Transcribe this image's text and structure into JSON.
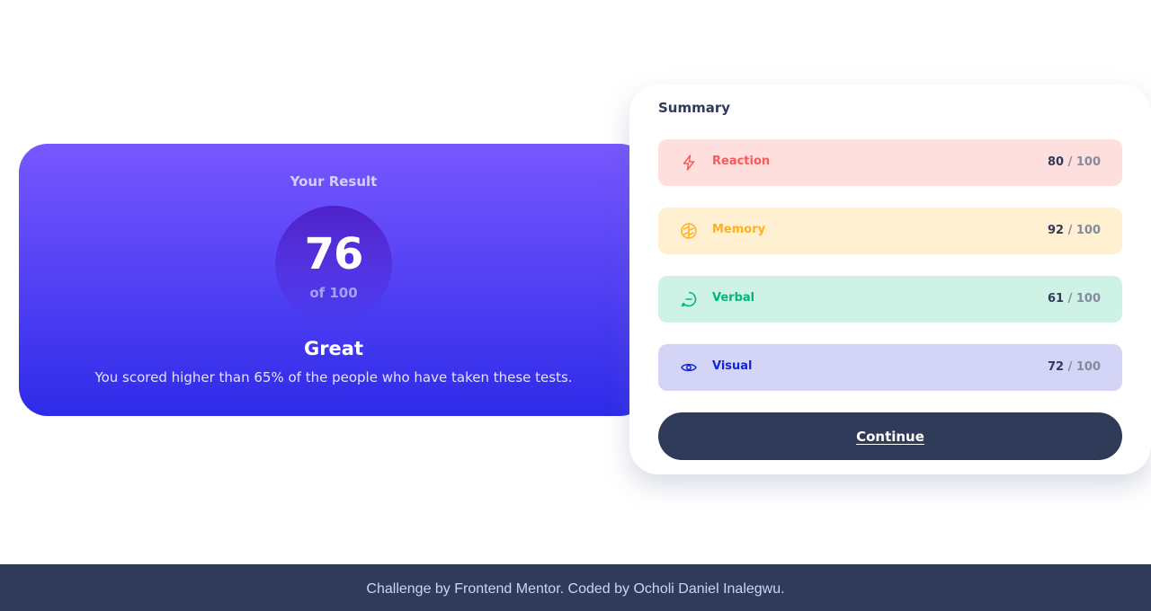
{
  "result": {
    "heading": "Your Result",
    "score": "76",
    "of_label": "of 100",
    "rating": "Great",
    "description": "You scored higher than 65% of the people who have taken these tests."
  },
  "summary": {
    "title": "Summary",
    "items": [
      {
        "label": "Reaction",
        "score": "80",
        "max": "/ 100",
        "icon": "lightning-icon",
        "color": "#f55b5b",
        "bg": "#ffdede"
      },
      {
        "label": "Memory",
        "score": "92",
        "max": "/ 100",
        "icon": "brain-icon",
        "color": "#ffb01f",
        "bg": "#fff0d2"
      },
      {
        "label": "Verbal",
        "score": "61",
        "max": "/ 100",
        "icon": "speech-bubble-icon",
        "color": "#00b87c",
        "bg": "#cef2e6"
      },
      {
        "label": "Visual",
        "score": "72",
        "max": "/ 100",
        "icon": "eye-icon",
        "color": "#1125d6",
        "bg": "#d3d4f6"
      }
    ],
    "continue_label": "Continue"
  },
  "footer": {
    "text": "Challenge by Frontend Mentor. Coded by Ocholi Daniel Inalegwu."
  }
}
